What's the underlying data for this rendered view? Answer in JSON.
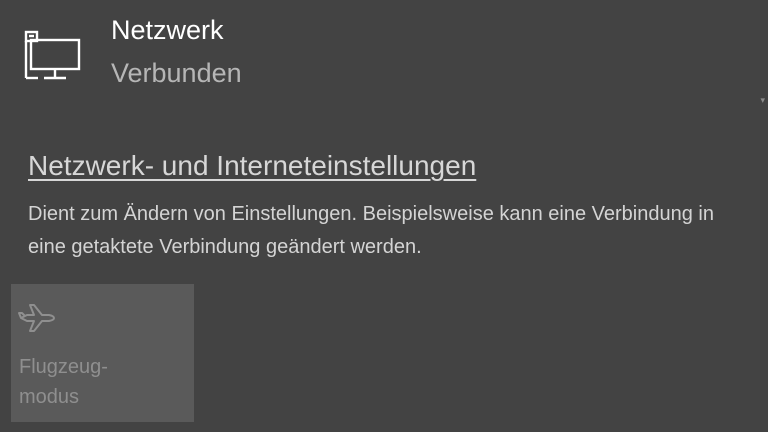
{
  "network": {
    "icon": "ethernet-desktop-icon",
    "name": "Netzwerk",
    "status": "Verbunden"
  },
  "settings": {
    "link_text": "Netzwerk- und Interneteinstellungen",
    "description": "Dient zum Ändern von Einstellungen. Beispielsweise kann eine Verbindung in eine getaktete Verbindung geändert werden."
  },
  "quick_actions": [
    {
      "icon": "airplane-icon",
      "label": "Flugzeug-\nmodus",
      "state": "off"
    }
  ],
  "colors": {
    "background": "#434343",
    "text_primary": "#ffffff",
    "text_secondary": "#b6b6b6",
    "tile_off": "#5a5a5a",
    "tile_text_off": "#8f8f8f"
  }
}
